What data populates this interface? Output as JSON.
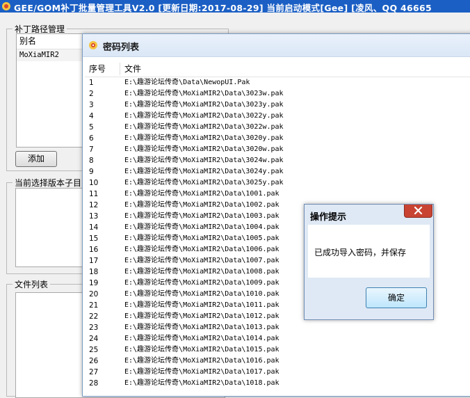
{
  "app": {
    "title": "GEE/GOM补丁批量管理工具V2.0 [更新日期:2017-08-29]   当前启动模式[Gee]   [凌风、QQ 46665"
  },
  "patch_group": {
    "title": "补丁路径管理",
    "column_alias": "别名",
    "rows": [
      "MoXiaMIR2"
    ],
    "add_button": "添加"
  },
  "subdir_group": {
    "title": "当前选择版本子目"
  },
  "file_group": {
    "title": "文件列表"
  },
  "password_window": {
    "title": "密码列表",
    "col_index": "序号",
    "col_file": "文件",
    "rows": [
      {
        "n": "1",
        "f": "E:\\趣游论坛传奇\\Data\\NewopUI.Pak"
      },
      {
        "n": "2",
        "f": "E:\\趣游论坛传奇\\MoXiaMIR2\\Data\\3023w.pak"
      },
      {
        "n": "3",
        "f": "E:\\趣游论坛传奇\\MoXiaMIR2\\Data\\3023y.pak"
      },
      {
        "n": "4",
        "f": "E:\\趣游论坛传奇\\MoXiaMIR2\\Data\\3022y.pak"
      },
      {
        "n": "5",
        "f": "E:\\趣游论坛传奇\\MoXiaMIR2\\Data\\3022w.pak"
      },
      {
        "n": "6",
        "f": "E:\\趣游论坛传奇\\MoXiaMIR2\\Data\\3020y.pak"
      },
      {
        "n": "7",
        "f": "E:\\趣游论坛传奇\\MoXiaMIR2\\Data\\3020w.pak"
      },
      {
        "n": "8",
        "f": "E:\\趣游论坛传奇\\MoXiaMIR2\\Data\\3024w.pak"
      },
      {
        "n": "9",
        "f": "E:\\趣游论坛传奇\\MoXiaMIR2\\Data\\3024y.pak"
      },
      {
        "n": "10",
        "f": "E:\\趣游论坛传奇\\MoXiaMIR2\\Data\\3025y.pak"
      },
      {
        "n": "11",
        "f": "E:\\趣游论坛传奇\\MoXiaMIR2\\Data\\1001.pak"
      },
      {
        "n": "12",
        "f": "E:\\趣游论坛传奇\\MoXiaMIR2\\Data\\1002.pak"
      },
      {
        "n": "13",
        "f": "E:\\趣游论坛传奇\\MoXiaMIR2\\Data\\1003.pak"
      },
      {
        "n": "14",
        "f": "E:\\趣游论坛传奇\\MoXiaMIR2\\Data\\1004.pak"
      },
      {
        "n": "15",
        "f": "E:\\趣游论坛传奇\\MoXiaMIR2\\Data\\1005.pak"
      },
      {
        "n": "16",
        "f": "E:\\趣游论坛传奇\\MoXiaMIR2\\Data\\1006.pak"
      },
      {
        "n": "17",
        "f": "E:\\趣游论坛传奇\\MoXiaMIR2\\Data\\1007.pak"
      },
      {
        "n": "18",
        "f": "E:\\趣游论坛传奇\\MoXiaMIR2\\Data\\1008.pak"
      },
      {
        "n": "19",
        "f": "E:\\趣游论坛传奇\\MoXiaMIR2\\Data\\1009.pak"
      },
      {
        "n": "20",
        "f": "E:\\趣游论坛传奇\\MoXiaMIR2\\Data\\1010.pak"
      },
      {
        "n": "21",
        "f": "E:\\趣游论坛传奇\\MoXiaMIR2\\Data\\1011.pak"
      },
      {
        "n": "22",
        "f": "E:\\趣游论坛传奇\\MoXiaMIR2\\Data\\1012.pak"
      },
      {
        "n": "23",
        "f": "E:\\趣游论坛传奇\\MoXiaMIR2\\Data\\1013.pak"
      },
      {
        "n": "24",
        "f": "E:\\趣游论坛传奇\\MoXiaMIR2\\Data\\1014.pak"
      },
      {
        "n": "25",
        "f": "E:\\趣游论坛传奇\\MoXiaMIR2\\Data\\1015.pak"
      },
      {
        "n": "26",
        "f": "E:\\趣游论坛传奇\\MoXiaMIR2\\Data\\1016.pak"
      },
      {
        "n": "27",
        "f": "E:\\趣游论坛传奇\\MoXiaMIR2\\Data\\1017.pak"
      },
      {
        "n": "28",
        "f": "E:\\趣游论坛传奇\\MoXiaMIR2\\Data\\1018.pak"
      }
    ]
  },
  "dialog": {
    "title": "操作提示",
    "message": "已成功导入密码，并保存",
    "ok_button": "确定",
    "close_icon": "close-icon"
  },
  "colors": {
    "titlebar": "#1b5fc4",
    "close_button": "#c94332"
  }
}
